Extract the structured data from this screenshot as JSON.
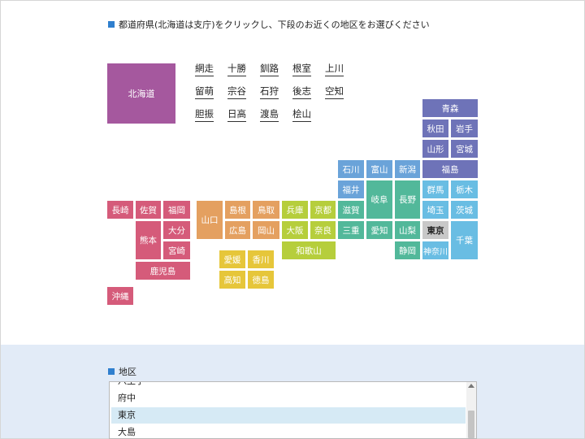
{
  "instruction": "都道府県(北海道は支庁)をクリックし、下段のお近くの地区をお選びください",
  "hokkaido": "北海道",
  "subprefectures": [
    "網走",
    "十勝",
    "釧路",
    "根室",
    "上川",
    "留萌",
    "宗谷",
    "石狩",
    "後志",
    "空知",
    "胆振",
    "日高",
    "渡島",
    "桧山"
  ],
  "prefectures": {
    "aomori": "青森",
    "akita": "秋田",
    "iwate": "岩手",
    "yamagata": "山形",
    "miyagi": "宮城",
    "fukushima": "福島",
    "ishikawa": "石川",
    "toyama": "富山",
    "niigata": "新潟",
    "fukui": "福井",
    "gifu": "岐阜",
    "nagano": "長野",
    "gunma": "群馬",
    "tochigi": "栃木",
    "saitama": "埼玉",
    "ibaraki": "茨城",
    "tokyo": "東京",
    "chiba": "千葉",
    "kanagawa": "神奈川",
    "yamanashi": "山梨",
    "shizuoka": "静岡",
    "aichi": "愛知",
    "mie": "三重",
    "shiga": "滋賀",
    "kyoto": "京都",
    "hyogo": "兵庫",
    "osaka": "大阪",
    "nara": "奈良",
    "wakayama": "和歌山",
    "tottori": "鳥取",
    "shimane": "島根",
    "okayama": "岡山",
    "hiroshima": "広島",
    "yamaguchi": "山口",
    "ehime": "愛媛",
    "kagawa": "香川",
    "kochi": "高知",
    "tokushima": "徳島",
    "nagasaki": "長崎",
    "saga": "佐賀",
    "fukuoka": "福岡",
    "kumamoto": "熊本",
    "oita": "大分",
    "miyazaki": "宮崎",
    "kagoshima": "鹿児島",
    "okinawa": "沖縄"
  },
  "district_heading": "地区",
  "district_list": [
    "八王子",
    "府中",
    "東京",
    "大島"
  ],
  "selected_district": "東京",
  "colors": {
    "hokkaido": "#a5589e",
    "tohoku": "#6e73b8",
    "chubu_north": "#6aa3d9",
    "chubu": "#52b89a",
    "kanto": "#69bde3",
    "tokyo": "#c8c8c8",
    "kinki": "#b6ce3c",
    "chugoku": "#e4a060",
    "shikoku": "#e6c63a",
    "kyushu": "#d55b7a",
    "accent": "#2f7fce",
    "panel_bg": "#e2ebf7"
  }
}
